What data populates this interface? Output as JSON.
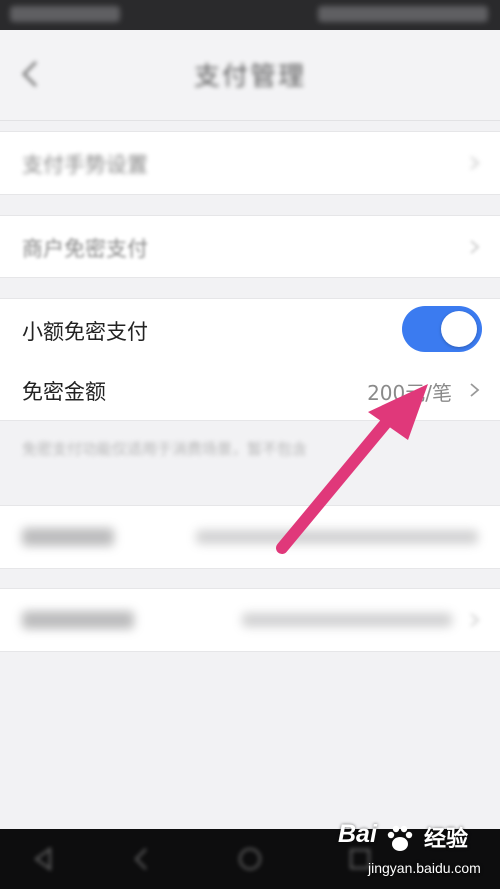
{
  "status_bar": {
    "left": "",
    "right": ""
  },
  "header": {
    "title": "支付管理"
  },
  "rows": {
    "payment_settings": {
      "label": "支付手势设置"
    },
    "merchant_nopwd": {
      "label": "商户免密支付"
    },
    "small_nopwd": {
      "label": "小额免密支付",
      "enabled": true
    },
    "nopwd_amount": {
      "label": "免密金额",
      "value": "200元/笔"
    },
    "deduct_order": {
      "label": "",
      "value": ""
    },
    "auto_renew": {
      "label": "",
      "value": ""
    }
  },
  "note": "免密支付功能仅适用于消费场景，暂不包含",
  "watermark": {
    "logo": "Bai",
    "brand": "经验",
    "url": "jingyan.baidu.com"
  },
  "colors": {
    "toggle_on": "#3b7bf0",
    "arrow": "#e0387a",
    "value_text": "#8a8a8a"
  },
  "icons": {
    "back": "chevron-left-icon",
    "row_arrow": "chevron-right-icon",
    "annotation": "arrow-icon"
  }
}
